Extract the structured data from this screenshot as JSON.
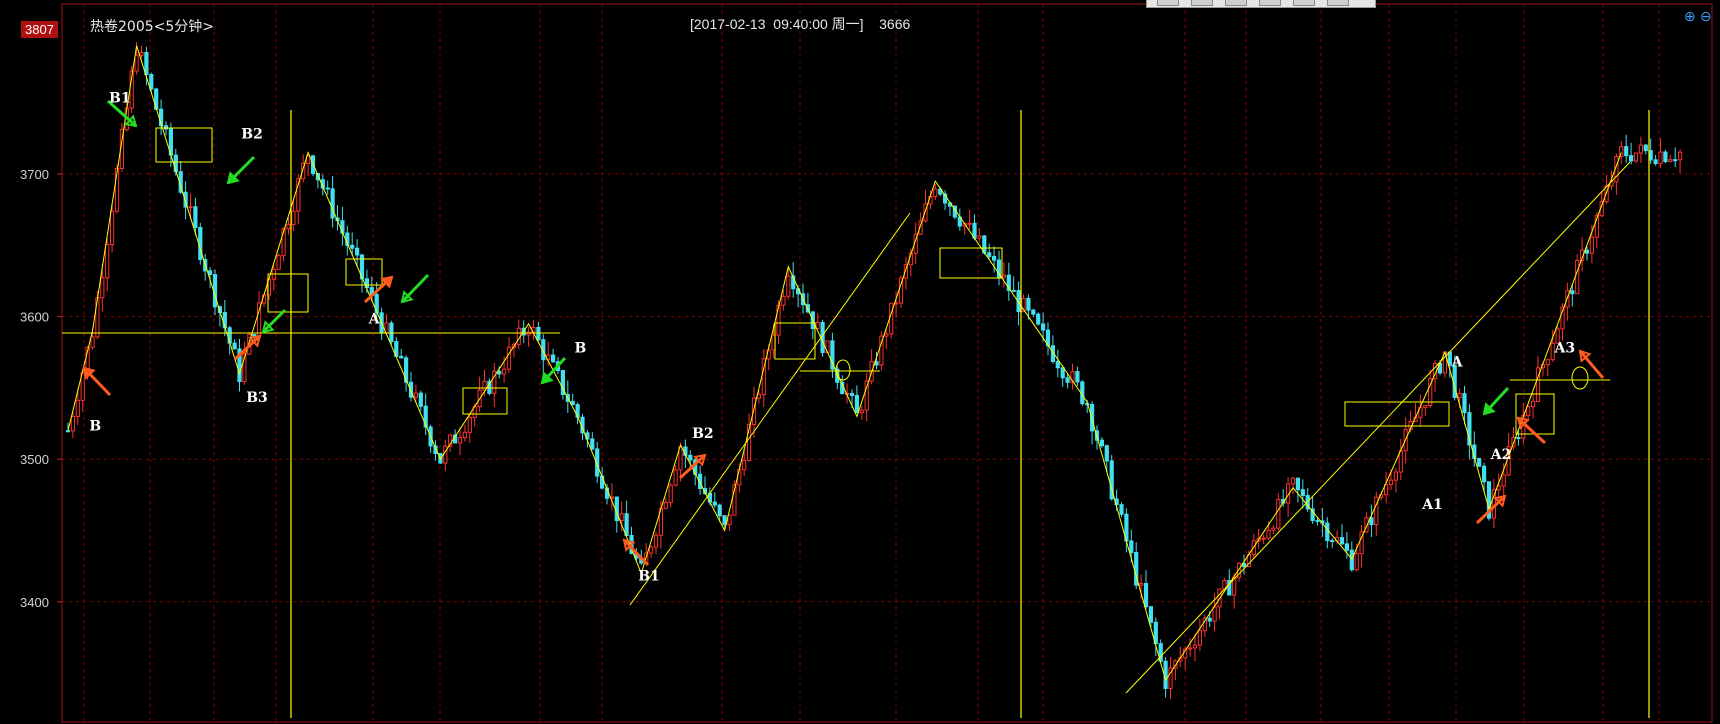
{
  "header": {
    "title": "热卷2005<5分钟>",
    "info": "[2017-02-13  09:40:00 周一]    3666",
    "price_tag": "3807"
  },
  "toolbar": {
    "buttons": [
      "btn1",
      "btn2",
      "btn3",
      "btn4",
      "btn5",
      "btn6"
    ]
  },
  "colors": {
    "up": "#ff3030",
    "down": "#40e0f0",
    "annotation_lines": "#ffff00",
    "grid": "#8b0000",
    "red_arrow": "#ff5a1f",
    "green_arrow": "#22dd22"
  },
  "chart_data": {
    "type": "candlestick",
    "ylim": [
      3340,
      3810
    ],
    "y_ticks": [
      "3700",
      "3600",
      "3500",
      "3400"
    ],
    "path_zigzag": [
      [
        0,
        3520
      ],
      [
        5,
        3590
      ],
      [
        14,
        3790
      ],
      [
        35,
        3560
      ],
      [
        49,
        3715
      ],
      [
        76,
        3500
      ],
      [
        94,
        3595
      ],
      [
        104,
        3530
      ],
      [
        117,
        3420
      ],
      [
        125,
        3510
      ],
      [
        134,
        3450
      ],
      [
        147,
        3635
      ],
      [
        161,
        3530
      ],
      [
        177,
        3695
      ],
      [
        208,
        3540
      ],
      [
        224,
        3345
      ],
      [
        250,
        3480
      ],
      [
        262,
        3430
      ],
      [
        281,
        3575
      ],
      [
        290,
        3465
      ],
      [
        317,
        3715
      ]
    ],
    "annotations": [
      {
        "text": "B1",
        "x": 10,
        "y": 3750
      },
      {
        "text": "B2",
        "x": 37,
        "y": 3725
      },
      {
        "text": "B3",
        "x": 38,
        "y": 3540
      },
      {
        "text": "B",
        "x": 6,
        "y": 3520
      },
      {
        "text": "A",
        "x": 63,
        "y": 3595
      },
      {
        "text": "B",
        "x": 105,
        "y": 3575
      },
      {
        "text": "B1",
        "x": 118,
        "y": 3415
      },
      {
        "text": "B2",
        "x": 129,
        "y": 3515
      },
      {
        "text": "A",
        "x": 284,
        "y": 3565
      },
      {
        "text": "A1",
        "x": 278,
        "y": 3465
      },
      {
        "text": "A2",
        "x": 292,
        "y": 3500
      },
      {
        "text": "A3",
        "x": 305,
        "y": 3575
      }
    ]
  }
}
